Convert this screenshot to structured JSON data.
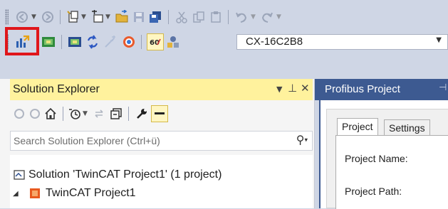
{
  "toolbar1": {
    "icons": [
      "back-icon",
      "forward-icon",
      "new-project-icon",
      "add-item-icon",
      "open-icon",
      "save-icon",
      "save-all-icon",
      "cut-icon",
      "copy-icon",
      "paste-icon",
      "undo-icon",
      "redo-icon"
    ]
  },
  "toolbar2": {
    "icons": [
      "activate-configuration-icon",
      "restart-twincat-icon",
      "build-icon",
      "reload-devices-icon",
      "scan-icon",
      "toggle-free-run-icon",
      "show-online-data-icon",
      "choose-target-icon"
    ],
    "target_combo_value": "CX-16C2B8"
  },
  "highlight_color": "#e0161b",
  "solution_explorer": {
    "title": "Solution Explorer",
    "title_bar_color": "#fff29d",
    "search_placeholder": "Search Solution Explorer (Ctrl+ü)",
    "tree": [
      {
        "label": "Solution 'TwinCAT Project1' (1 project)",
        "icon": "solution-icon",
        "level": 0
      },
      {
        "label": "TwinCAT Project1",
        "icon": "twincat-project-icon",
        "level": 1,
        "expanded": true
      }
    ]
  },
  "profibus_panel": {
    "tab_title": "Profibus Project",
    "tab_color": "#3d5a91",
    "tabs": [
      "Project",
      "Settings"
    ],
    "fields": [
      "Project Name:",
      "Project Path:"
    ]
  }
}
